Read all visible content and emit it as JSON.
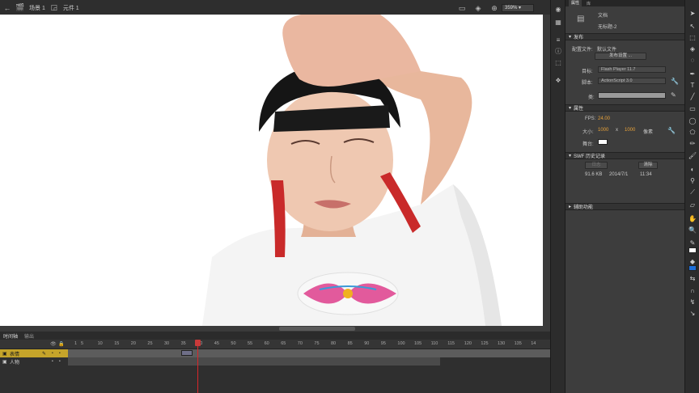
{
  "topbar": {
    "scene_label": "场景 1",
    "symbol_label": "元件 1",
    "zoom_value": "359%"
  },
  "timeline": {
    "tabs": [
      "时间轴",
      "输出"
    ],
    "ruler": [
      "1",
      "5",
      "10",
      "15",
      "20",
      "25",
      "30",
      "35",
      "40",
      "45",
      "50",
      "55",
      "60",
      "65",
      "70",
      "75",
      "80",
      "85",
      "90",
      "95",
      "100",
      "105",
      "110",
      "115",
      "120",
      "125",
      "130",
      "135",
      "14"
    ],
    "layers": [
      {
        "name": "表情",
        "selected": true
      },
      {
        "name": "人物",
        "selected": false
      }
    ]
  },
  "panel": {
    "tabs": [
      "属性",
      "库"
    ],
    "doc_type": "文档",
    "doc_name": "无标题-2",
    "publish": {
      "header": "发布",
      "profile_label": "配置文件:",
      "profile_value": "默认文件",
      "settings_button": "发布设置 ...",
      "target_label": "目标:",
      "target_value": "Flash Player 11.7",
      "script_label": "脚本:",
      "script_value": "ActionScript 3.0",
      "class_label": "类:"
    },
    "properties": {
      "header": "属性",
      "fps_label": "FPS:",
      "fps_value": "24.00",
      "size_label": "大小:",
      "width": "1000",
      "x_sep": "x",
      "height": "1000",
      "unit": "像素",
      "stage_label": "舞台:"
    },
    "swf_history": {
      "header": "SWF 历史记录",
      "log_button": "日志",
      "clear_button": "清除",
      "size": "91.6 KB",
      "date": "2014/7/1",
      "time": "11:34"
    },
    "accessibility": {
      "header": "辅助功能"
    }
  },
  "colors": {
    "selected_layer": "#c5a42a",
    "playhead": "#d9262a",
    "accent_value": "#e8a23a",
    "fill_swatch": "#1e6fd9"
  }
}
